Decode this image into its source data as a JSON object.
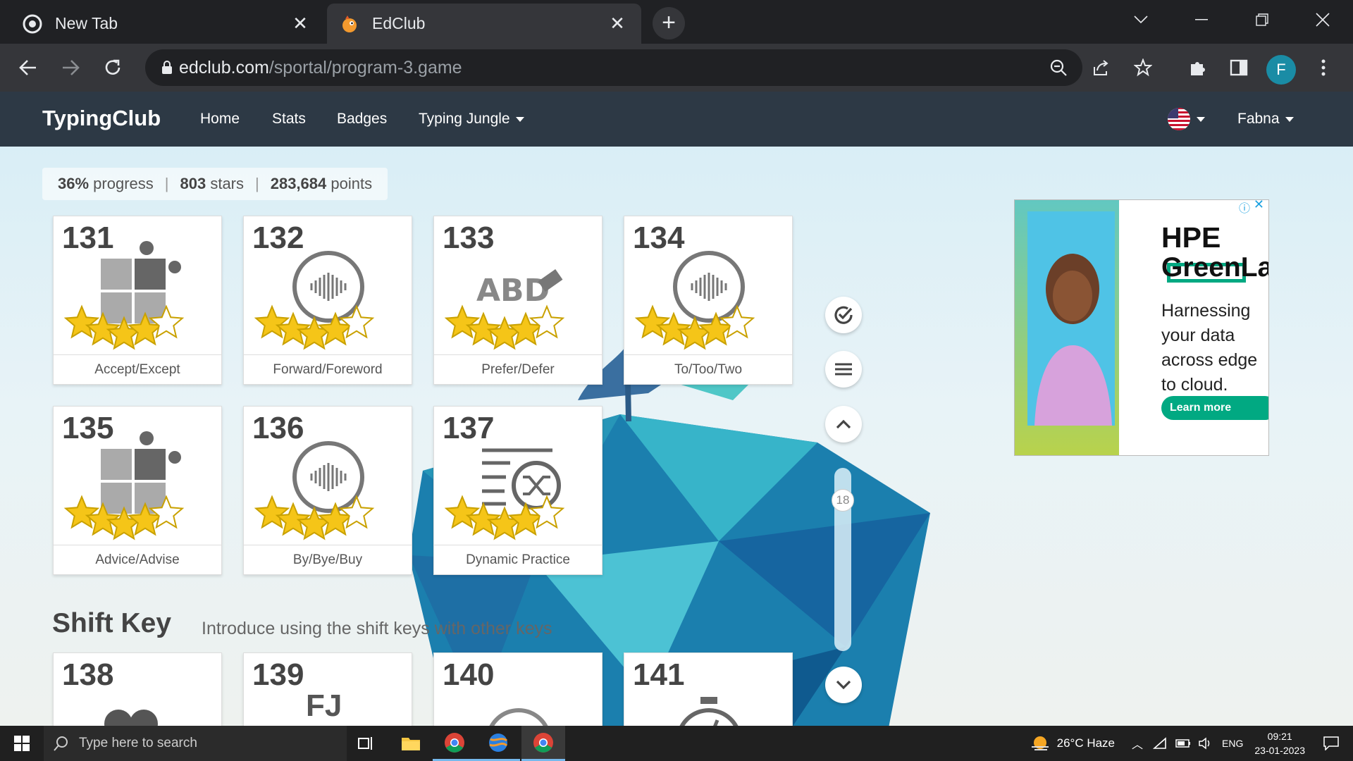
{
  "browser": {
    "tabs": [
      {
        "title": "New Tab",
        "icon": "chrome-icon",
        "active": false
      },
      {
        "title": "EdClub",
        "icon": "edclub-favicon",
        "active": true
      }
    ],
    "url_host": "edclub.com",
    "url_path": "/sportal/program-3.game",
    "profile_initial": "F",
    "accent": "#1a8ca5"
  },
  "site": {
    "brand": "TypingClub",
    "nav": {
      "home": "Home",
      "stats": "Stats",
      "badges": "Badges",
      "typing_jungle": "Typing Jungle",
      "user": "Fabna"
    }
  },
  "progress": {
    "percent": "36%",
    "percent_label": "progress",
    "stars": "803",
    "stars_label": "stars",
    "points": "283,684",
    "points_label": "points"
  },
  "lessons": [
    {
      "number": "131",
      "name": "Accept/Except",
      "icon": "puzzle-icon",
      "stars": 5
    },
    {
      "number": "132",
      "name": "Forward/Foreword",
      "icon": "audio-wave-icon",
      "stars": 5
    },
    {
      "number": "133",
      "name": "Prefer/Defer",
      "icon": "abc-eraser-icon",
      "stars": 5
    },
    {
      "number": "134",
      "name": "To/Too/Two",
      "icon": "audio-wave-icon",
      "stars": 5
    },
    {
      "number": "135",
      "name": "Advice/Advise",
      "icon": "puzzle-icon",
      "stars": 5
    },
    {
      "number": "136",
      "name": "By/Bye/Buy",
      "icon": "audio-wave-icon",
      "stars": 5
    },
    {
      "number": "137",
      "name": "Dynamic Practice",
      "icon": "shuffle-icon",
      "stars": 5
    }
  ],
  "section": {
    "title": "Shift Key",
    "description": "Introduce using the shift keys with other keys"
  },
  "next_lessons": [
    {
      "number": "138",
      "icon": "keys-icon"
    },
    {
      "number": "139",
      "icon": "fj-keys-icon",
      "glyph": "FJ"
    },
    {
      "number": "140",
      "icon": "gauge-icon"
    },
    {
      "number": "141",
      "icon": "stopwatch-icon"
    }
  ],
  "scroll_level": "18",
  "ad": {
    "brand": "HPE",
    "product": "GreenLake",
    "body": "Harnessing your data across edge to cloud.",
    "cta": "Learn more",
    "color": "#01a982"
  },
  "taskbar": {
    "search_placeholder": "Type here to search",
    "weather": "26°C  Haze",
    "lang": "ENG",
    "time": "09:21",
    "date": "23-01-2023"
  }
}
